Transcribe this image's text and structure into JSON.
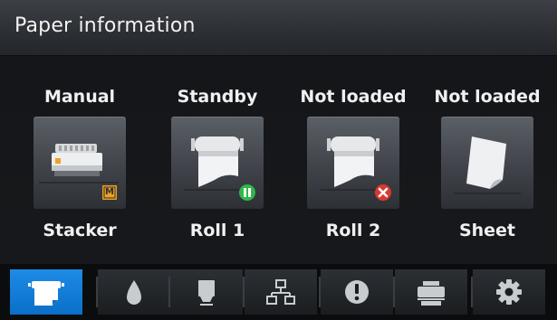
{
  "header": {
    "title": "Paper information"
  },
  "sources": [
    {
      "status": "Manual",
      "name": "Stacker",
      "icon": "stacker-icon",
      "badge": "M",
      "badge_color": "#f0a020"
    },
    {
      "status": "Standby",
      "name": "Roll 1",
      "icon": "roll-icon",
      "badge": "pause",
      "badge_color": "#2eb84a"
    },
    {
      "status": "Not loaded",
      "name": "Roll 2",
      "icon": "roll-icon",
      "badge": "error",
      "badge_color": "#d83a30"
    },
    {
      "status": "Not loaded",
      "name": "Sheet",
      "icon": "sheet-icon"
    }
  ],
  "tabs": [
    {
      "icon": "paper-icon",
      "active": true
    },
    {
      "icon": "ink-drop-icon",
      "active": false
    },
    {
      "icon": "printhead-icon",
      "active": false
    },
    {
      "icon": "network-icon",
      "active": false
    },
    {
      "icon": "alert-icon",
      "active": false
    },
    {
      "icon": "printer-icon",
      "active": false
    },
    {
      "icon": "gear-icon",
      "active": false
    }
  ],
  "colors": {
    "accent": "#1a84e0"
  }
}
